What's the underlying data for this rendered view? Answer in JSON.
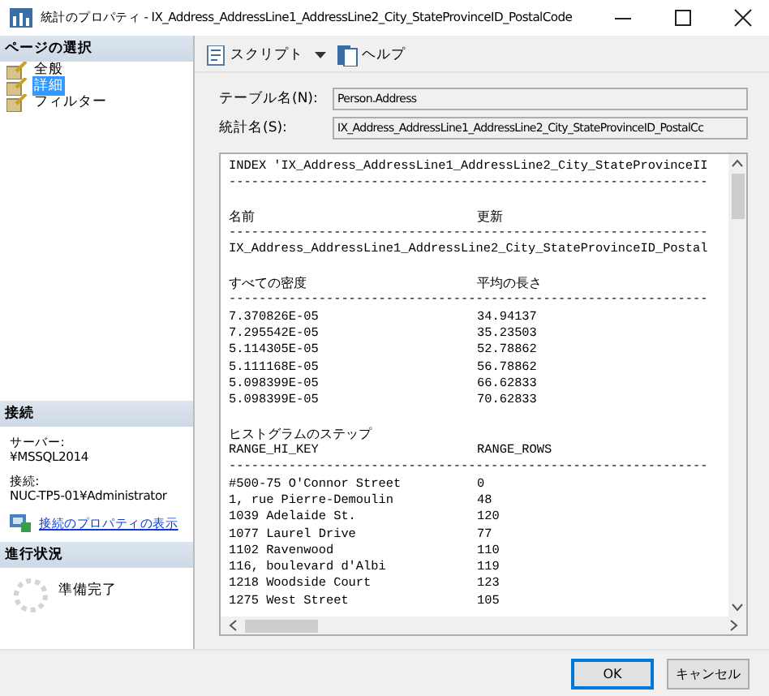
{
  "window": {
    "title": "統計のプロパティ - IX_Address_AddressLine1_AddressLine2_City_StateProvinceID_PostalCode"
  },
  "sidebar": {
    "pages_header": "ページの選択",
    "pages": [
      {
        "label": "全般",
        "selected": false
      },
      {
        "label": "詳細",
        "selected": true
      },
      {
        "label": "フィルター",
        "selected": false
      }
    ],
    "connection": {
      "header": "接続",
      "server_label": "サーバー:",
      "server": "¥MSSQL2014",
      "connection_label": "接続:",
      "connection": "NUC-TP5-01¥Administrator",
      "link": "接続のプロパティの表示"
    },
    "progress": {
      "header": "進行状況",
      "status": "準備完了"
    }
  },
  "toolbar": [
    {
      "kind": "script",
      "label": "スクリプト",
      "dropdown": true
    },
    {
      "kind": "help",
      "label": "ヘルプ",
      "dropdown": false
    }
  ],
  "fields": [
    {
      "label": "テーブル名(N):",
      "value": "Person.Address"
    },
    {
      "label": "統計名(S):",
      "value": "IX_Address_AddressLine1_AddressLine2_City_StateProvinceID_PostalCc"
    }
  ],
  "details": {
    "lines": [
      {
        "kind": "text",
        "text": "INDEX 'IX_Address_AddressLine1_AddressLine2_City_StateProvinceII"
      },
      {
        "kind": "rule",
        "text": "----------------------------------------------------------------"
      },
      {
        "kind": "gap"
      },
      {
        "kind": "heading",
        "cells": [
          "名前",
          "更新"
        ]
      },
      {
        "kind": "rule",
        "text": "----------------------------------------------------------------"
      },
      {
        "kind": "text",
        "text": "IX_Address_AddressLine1_AddressLine2_City_StateProvinceID_Postal"
      },
      {
        "kind": "gap"
      },
      {
        "kind": "heading",
        "cells": [
          "すべての密度",
          "平均の長さ"
        ]
      },
      {
        "kind": "rule",
        "text": "----------------------------------------------------------------"
      },
      {
        "kind": "row",
        "cells": [
          "7.370826E-05",
          "34.94137"
        ]
      },
      {
        "kind": "row",
        "cells": [
          "7.295542E-05",
          "35.23503"
        ]
      },
      {
        "kind": "row",
        "cells": [
          "5.114305E-05",
          "52.78862"
        ]
      },
      {
        "kind": "row",
        "cells": [
          "5.111168E-05",
          "56.78862"
        ]
      },
      {
        "kind": "row",
        "cells": [
          "5.098399E-05",
          "66.62833"
        ]
      },
      {
        "kind": "row",
        "cells": [
          "5.098399E-05",
          "70.62833"
        ]
      },
      {
        "kind": "gap"
      },
      {
        "kind": "caption",
        "text": "ヒストグラムのステップ"
      },
      {
        "kind": "row",
        "cells": [
          "RANGE_HI_KEY",
          "RANGE_ROWS"
        ]
      },
      {
        "kind": "rule",
        "text": "----------------------------------------------------------------"
      },
      {
        "kind": "row",
        "cells": [
          "#500-75 O'Connor Street",
          "0"
        ]
      },
      {
        "kind": "row",
        "cells": [
          "1, rue Pierre-Demoulin",
          "48"
        ]
      },
      {
        "kind": "row",
        "cells": [
          "1039 Adelaide St.",
          "120"
        ]
      },
      {
        "kind": "row",
        "cells": [
          "1077 Laurel Drive",
          "77"
        ]
      },
      {
        "kind": "row",
        "cells": [
          "1102 Ravenwood",
          "110"
        ]
      },
      {
        "kind": "row",
        "cells": [
          "116, boulevard d'Albi",
          "119"
        ]
      },
      {
        "kind": "row",
        "cells": [
          "1218 Woodside Court",
          "123"
        ]
      },
      {
        "kind": "row",
        "cells": [
          "1275 West Street",
          "105"
        ]
      }
    ]
  },
  "buttons": [
    {
      "label": "OK",
      "default": true
    },
    {
      "label": "キャンセル",
      "default": false
    }
  ]
}
